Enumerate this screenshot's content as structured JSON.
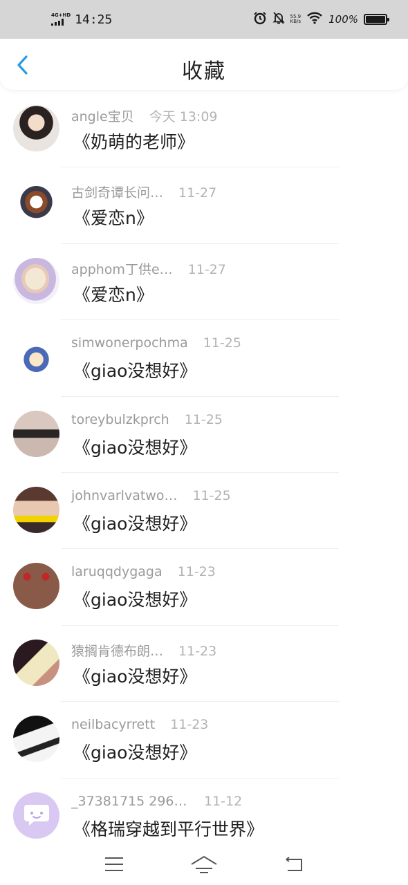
{
  "status_bar": {
    "network": "4G+HD",
    "time": "14:25",
    "speed_value": "55.9",
    "speed_unit": "KB/s",
    "battery": "100%",
    "icons": [
      "signal-icon",
      "alarm-icon",
      "mute-bell-icon",
      "wifi-icon",
      "battery-icon"
    ]
  },
  "header": {
    "title": "收藏",
    "back_icon": "chevron-left-icon",
    "accent_color": "#2a9ae0"
  },
  "favorites": [
    {
      "username": "angle宝贝",
      "date": "今天 13:09",
      "title": "《奶萌的老师》",
      "avatar": "woman-portrait"
    },
    {
      "username": "古剑奇谭长问…",
      "date": "11-27",
      "title": "《爱恋n》",
      "avatar": "cartoon-warrior"
    },
    {
      "username": "apphom丁供e…",
      "date": "11-27",
      "title": "《爱恋n》",
      "avatar": "food-plate"
    },
    {
      "username": "simwonerpochma",
      "date": "11-25",
      "title": "《giao没想好》",
      "avatar": "cartoon-official"
    },
    {
      "username": "toreybulzkprch",
      "date": "11-25",
      "title": "《giao没想好》",
      "avatar": "mustache-finger"
    },
    {
      "username": "johnvarlvatwo…",
      "date": "11-25",
      "title": "《giao没想好》",
      "avatar": "girl-with-caption"
    },
    {
      "username": "laruqqdygaga",
      "date": "11-23",
      "title": "《giao没想好》",
      "avatar": "earrings"
    },
    {
      "username": "猿搁肯德布朗…",
      "date": "11-23",
      "title": "《giao没想好》",
      "avatar": "girl-with-card"
    },
    {
      "username": "neilbacyrrett",
      "date": "11-23",
      "title": "《giao没想好》",
      "avatar": "anime-sketch"
    },
    {
      "username": "_37381715 2964…",
      "date": "11-12",
      "title": "《格瑞穿越到平行世界》",
      "avatar": "chat-bubble-purple"
    }
  ],
  "nav_bar": {
    "buttons": [
      "menu-icon",
      "home-icon",
      "back-icon"
    ]
  }
}
